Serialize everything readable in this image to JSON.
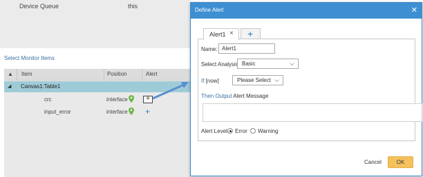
{
  "background": {
    "device_queue_label": "Device Queue",
    "device_queue_value": "this",
    "section_title": "Select Monitor Items",
    "grid": {
      "columns": [
        "Item",
        "Position",
        "Alert"
      ],
      "group": "Canvas1:Table1",
      "rows": [
        {
          "item": "crc",
          "position": "interface"
        },
        {
          "item": "input_error",
          "position": "interface"
        }
      ]
    }
  },
  "dialog": {
    "title": "Define Alert",
    "tabs": [
      {
        "label": "Alert1"
      }
    ],
    "name_label": "Name:",
    "name_value": "Alert1",
    "analysis_label": "Select Analysis",
    "analysis_value": "Basic",
    "if_label": "If",
    "if_now": "[now]",
    "condition_placeholder": "Please Select",
    "then_output": "Then Output",
    "alert_message": "Alert Message",
    "alert_level_label": "Alert Level:",
    "levels": [
      "Error",
      "Warning"
    ],
    "selected_level": "Error",
    "cancel": "Cancel",
    "ok": "OK"
  },
  "colors": {
    "header_blue": "#3d8fd1",
    "link_blue": "#3a6ea5",
    "group_row": "#9fcbd8",
    "ok_button": "#f5c15c"
  },
  "icons": {
    "close": "close-icon",
    "tab_close": "tab-close-icon",
    "add_tab": "add-tab-icon",
    "chevron": "chevron-down-icon",
    "pin": "location-pin-icon",
    "add_alert": "add-icon"
  }
}
